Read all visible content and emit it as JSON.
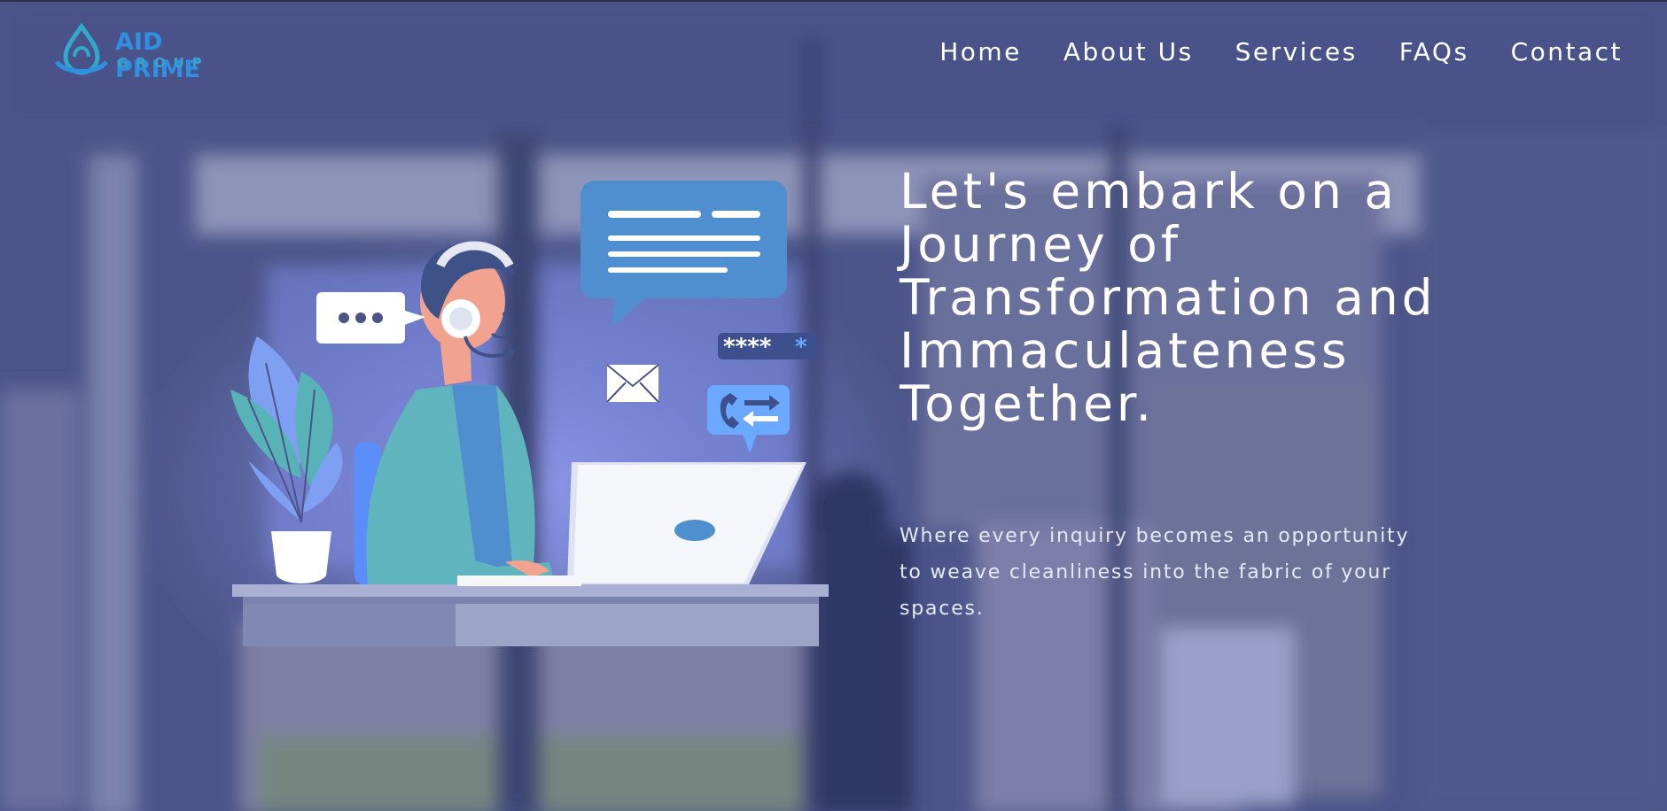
{
  "brand": {
    "name": "AID PRIME",
    "sub": "GROUP",
    "primary_color": "#2f8fe0",
    "secondary_color": "#3aa3c8"
  },
  "nav": {
    "items": [
      "Home",
      "About Us",
      "Services",
      "FAQs",
      "Contact"
    ]
  },
  "hero": {
    "title": "Let's embark on a Journey of Transformation and Immaculateness Together.",
    "subtitle": "Where every inquiry becomes an opportunity to weave cleanliness into the fabric of your spaces."
  },
  "illustration": {
    "password_text": "****",
    "password_accent": "*",
    "icons": [
      "chat-bubble-icon",
      "typing-bubble-icon",
      "envelope-icon",
      "phone-transfer-icon",
      "password-field-icon"
    ]
  },
  "colors": {
    "overlay": "#4a5488",
    "text": "#ffffff"
  }
}
